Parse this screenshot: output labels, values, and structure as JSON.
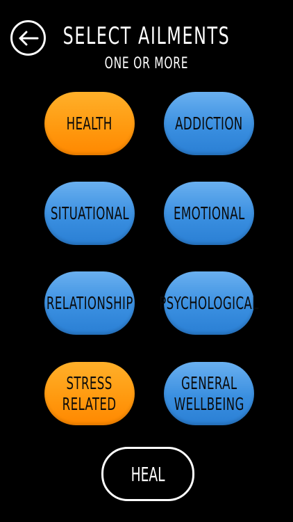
{
  "header": {
    "title": "SELECT AILMENTS",
    "subtitle": "ONE OR MORE",
    "back_icon": "arrow-left-icon"
  },
  "ailments": [
    {
      "label": "HEALTH",
      "selected": true
    },
    {
      "label": "ADDICTION",
      "selected": false
    },
    {
      "label": "SITUATIONAL",
      "selected": false
    },
    {
      "label": "EMOTIONAL",
      "selected": false
    },
    {
      "label": "RELATIONSHIP",
      "selected": false
    },
    {
      "label": "PSYCHOLOGICAL",
      "selected": false
    },
    {
      "label": "STRESS\nRELATED",
      "selected": true
    },
    {
      "label": "GENERAL\nWELLBEING",
      "selected": false
    }
  ],
  "action": {
    "heal_label": "HEAL"
  },
  "colors": {
    "background": "#000000",
    "selected": "#ff9a10",
    "unselected": "#3a8fe0",
    "foreground": "#ffffff"
  }
}
